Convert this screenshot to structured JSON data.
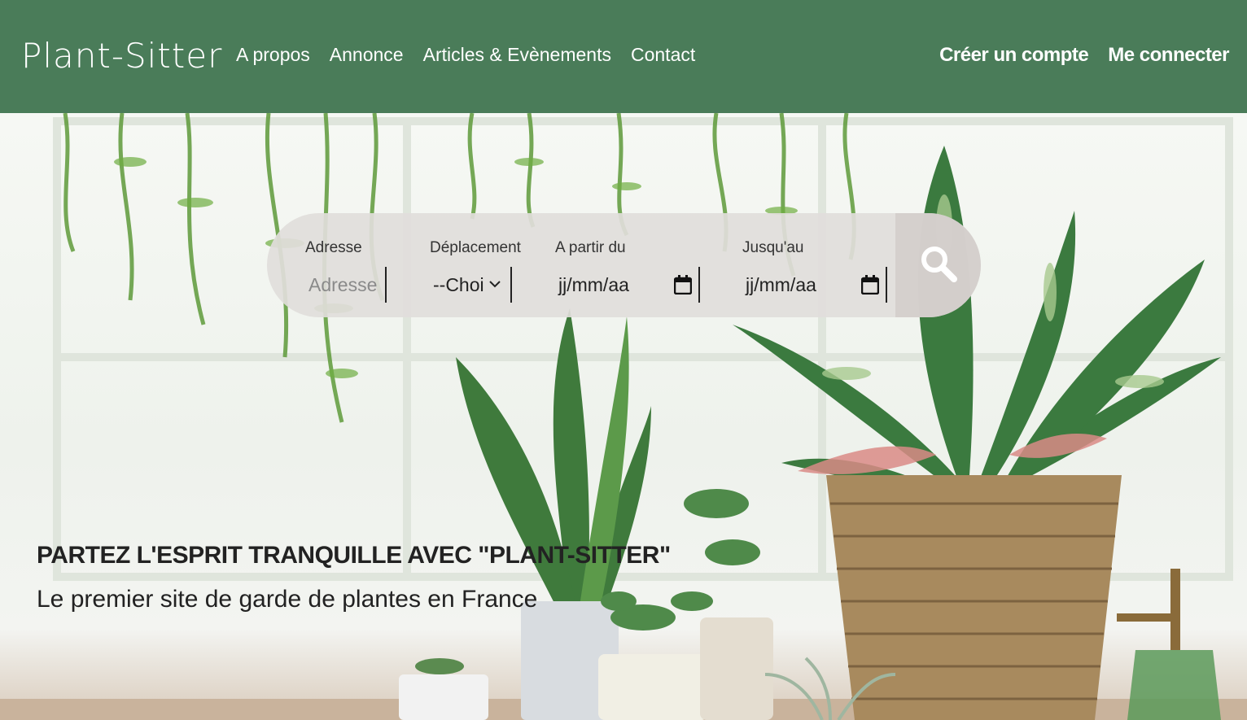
{
  "header": {
    "logo": "Plant-Sitter",
    "nav": [
      "A propos",
      "Annonce",
      "Articles & Evènements",
      "Contact"
    ],
    "auth": {
      "signup": "Créer un compte",
      "login": "Me connecter"
    },
    "background_color": "#4a7c59"
  },
  "search": {
    "address": {
      "label": "Adresse",
      "placeholder": "Adresse"
    },
    "travel": {
      "label": "Déplacement",
      "selected": "--Choi"
    },
    "from": {
      "label": "A partir du",
      "value": "jj/mm/aa"
    },
    "until": {
      "label": "Jusqu'au",
      "value": "jj/mm/aa"
    },
    "button_icon": "search-icon"
  },
  "hero": {
    "tagline": "PARTEZ L'ESPRIT TRANQUILLE AVEC \"PLANT-SITTER\"",
    "subline": "Le premier site de garde de plantes en France"
  }
}
